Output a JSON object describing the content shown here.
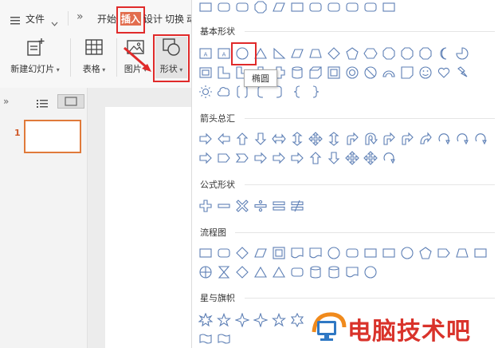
{
  "menu": {
    "file_label": "文件",
    "more_label": "»",
    "tabs": [
      "开始",
      "插入",
      "设计",
      "切换",
      "动"
    ],
    "active_tab": "插入"
  },
  "toolbar": {
    "new_slide_label": "新建幻灯片",
    "table_label": "表格",
    "picture_label": "图片",
    "shape_label": "形状"
  },
  "slides": {
    "thumb_number": "1"
  },
  "panel": {
    "categories": {
      "basic": "基本形状",
      "arrows": "箭头总汇",
      "formula": "公式形状",
      "flowchart": "流程图",
      "stars": "星与旗帜"
    },
    "tooltip": "椭圆"
  },
  "watermark": {
    "text": "电脑技术吧"
  },
  "colors": {
    "highlight": "#e02a2a",
    "shape_stroke": "#5d7fb5",
    "watermark": "#d9332b"
  }
}
